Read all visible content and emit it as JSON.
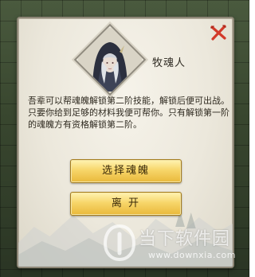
{
  "npc": {
    "name": "牧魂人",
    "avatar_icon": "hooded-npc-portrait-icon",
    "dialogue_lines": [
      "吾辈可以帮魂魄解锁第二阶技能，解锁后便可出战。",
      "只要你给到足够的材料我便可帮你。只有解锁第一阶",
      "的魂魄方有资格解锁第二阶。"
    ]
  },
  "buttons": {
    "select_label": "选择魂魄",
    "leave_label": "离  开"
  },
  "close_icon": "close-x-icon",
  "watermark": {
    "title": "当下软件园",
    "url": "www.downxia.com"
  },
  "colors": {
    "close_red": "#d23a2a",
    "button_gold": "#f7d66a",
    "panel_bg": "#ece8dc"
  }
}
